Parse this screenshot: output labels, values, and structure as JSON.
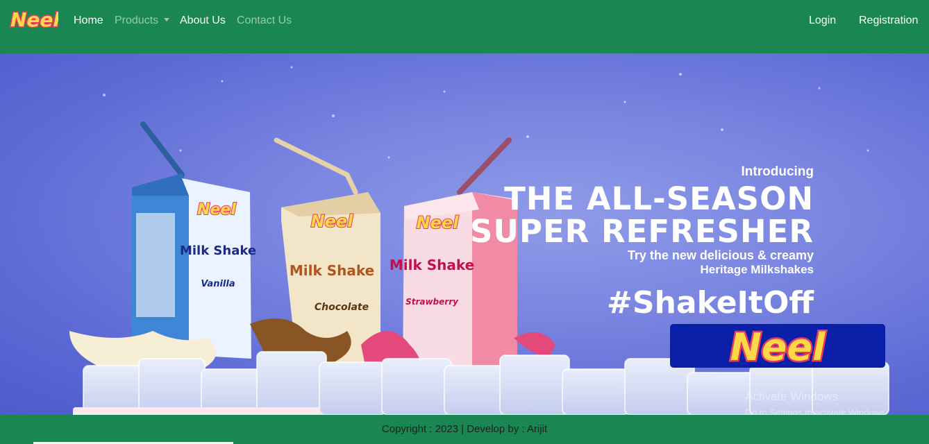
{
  "nav": {
    "brand": "Neel",
    "items": [
      {
        "label": "Home",
        "state": "active"
      },
      {
        "label": "Products",
        "state": "muted",
        "dropdown": true
      },
      {
        "label": "About Us",
        "state": "active"
      },
      {
        "label": "Contact Us",
        "state": "muted"
      }
    ],
    "login": "Login",
    "registration": "Registration"
  },
  "hero": {
    "intro": "Introducing",
    "headline_line1": "THE ALL-SEASON",
    "headline_line2": "SUPER REFRESHER",
    "try_line": "Try the new delicious & creamy",
    "heritage_line": "Heritage Milkshakes",
    "hashtag": "#ShakeItOff",
    "logo_text": "Neel",
    "products": [
      {
        "brand": "Neel",
        "name": "Milk Shake",
        "flavor": "Vanilla"
      },
      {
        "brand": "Neel",
        "name": "Milk Shake",
        "flavor": "Chocolate"
      },
      {
        "brand": "Neel",
        "name": "Milk Shake",
        "flavor": "Strawberry"
      }
    ]
  },
  "watermark": {
    "line1": "Activate Windows",
    "line2": "Go to Settings to activate Windows."
  },
  "footer": {
    "text": "Copyright : 2023 | Develop by : Arijit"
  },
  "colors": {
    "nav_bg": "#1a8752",
    "hero_bg": "#7a86e0",
    "logo_box": "#0a1fa8",
    "vanilla_pack": "#3f86d6",
    "chocolate_pack": "#f3e6c8",
    "strawberry_pack": "#f4a7b9"
  }
}
